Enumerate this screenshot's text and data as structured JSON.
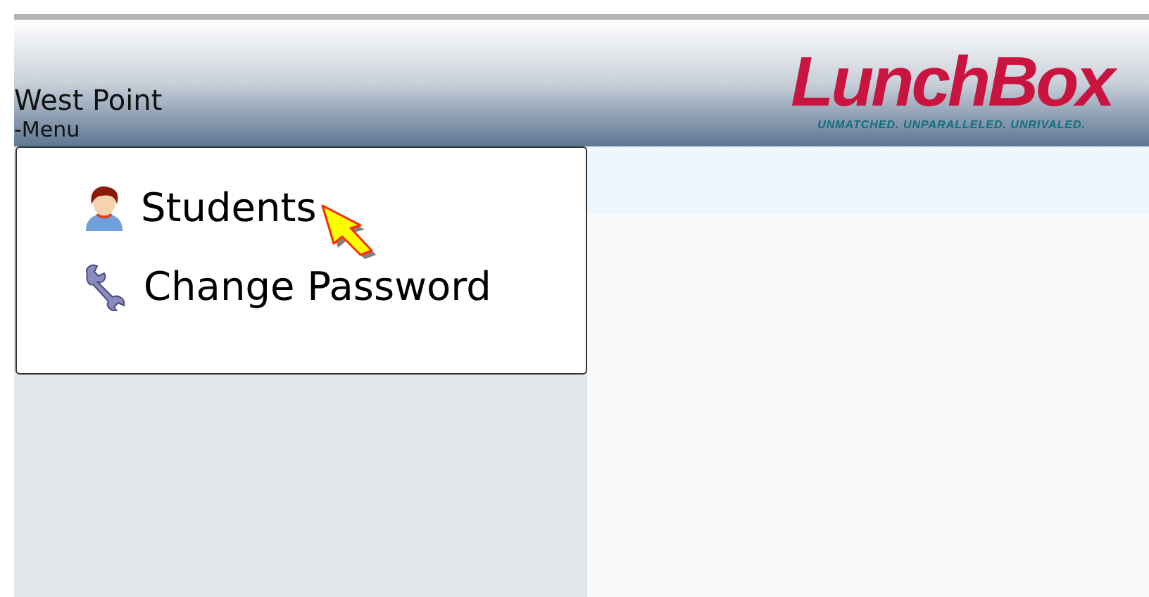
{
  "header": {
    "school": "West Point",
    "breadcrumb": "-Menu",
    "logo": "LunchBox",
    "tagline": "UNMATCHED. UNPARALLELED. UNRIVALED."
  },
  "menu": [
    {
      "kind": "person",
      "label": "Students"
    },
    {
      "kind": "wrench",
      "label": "Change Password"
    }
  ]
}
